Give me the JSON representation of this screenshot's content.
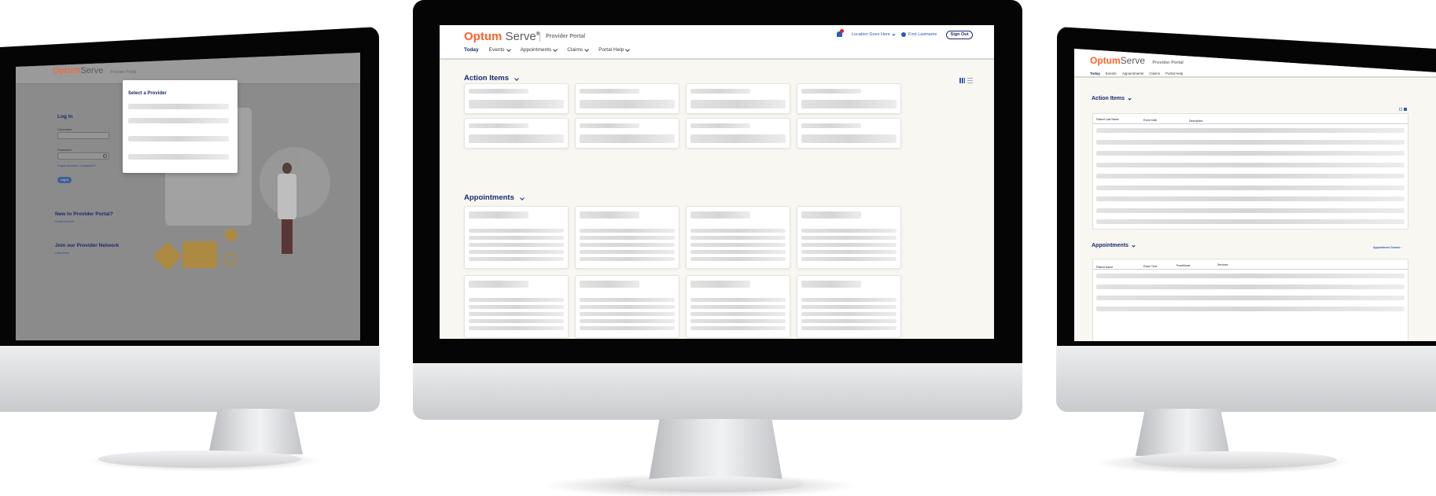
{
  "app": {
    "brand_optum": "Optum",
    "brand_serve": "Serve",
    "brand_mark": "®",
    "portal_name": "Provider Portal"
  },
  "header": {
    "location": "Location Goes Here",
    "user": "First Lastname",
    "sign_out": "Sign Out"
  },
  "nav": {
    "today": "Today",
    "events": "Events",
    "appointments": "Appointments",
    "claims": "Claims",
    "portal_help": "Portal Help"
  },
  "sections": {
    "action_items": "Action Items",
    "appointments": "Appointments"
  },
  "table_right": {
    "action_headers": [
      "Patient Last Name",
      "Event Date",
      "Description"
    ],
    "appointment_headers": [
      "Patient Name",
      "Exam Time",
      "Practitioner",
      "Services"
    ],
    "appointment_link": "Appointment Search ›"
  },
  "login": {
    "title": "Log In",
    "username_label": "Username",
    "password_label": "Password",
    "forgot": "Forgot username or password?",
    "login_button": "Log In",
    "new_title": "New to Provider Portal?",
    "new_link": "Create Account",
    "join_title": "Join our Provider Network",
    "join_link": "Learn More"
  },
  "modal": {
    "title": "Select a Provider"
  },
  "colors": {
    "brand_orange": "#ff612b",
    "navy": "#1a2a6c",
    "background": "#f8f7f2"
  }
}
